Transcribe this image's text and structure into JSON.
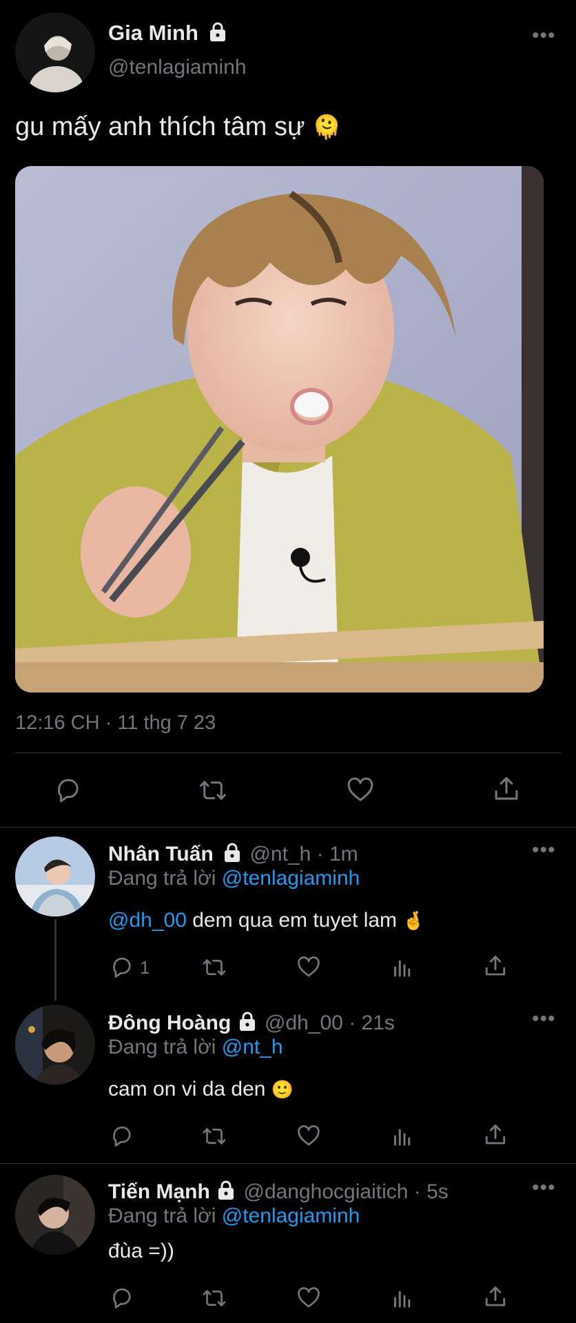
{
  "main_tweet": {
    "display_name": "Gia Minh",
    "handle": "@tenlagiaminh",
    "text": "gu mấy anh thích tâm sự",
    "emoji": "🫠",
    "timestamp": "12:16 CH · 11 thg 7 23"
  },
  "replies": [
    {
      "display_name": "Nhân Tuấn",
      "handle_time": "@nt_h · 1m",
      "replying_prefix": "Đang trả lời",
      "replying_to": "@tenlagiaminh",
      "mention": "@dh_00",
      "text": "dem qua em tuyet lam",
      "emoji": "🤞",
      "reply_count": "1"
    },
    {
      "display_name": "Đông Hoàng",
      "handle_time": "@dh_00 · 21s",
      "replying_prefix": "Đang trả lời",
      "replying_to": "@nt_h",
      "text": "cam on vi da den",
      "emoji": "🙂"
    },
    {
      "display_name": "Tiến Mạnh",
      "handle_time": "@danghocgiaitich · 5s",
      "replying_prefix": "Đang trả lời",
      "replying_to": "@tenlagiaminh",
      "text": "đùa =))"
    }
  ],
  "icons": {
    "more": "more-icon",
    "lock": "lock-icon",
    "reply": "reply-icon",
    "retweet": "retweet-icon",
    "like": "like-icon",
    "views": "views-icon",
    "share": "share-icon"
  },
  "colors": {
    "background": "#000000",
    "text": "#e7e9ea",
    "secondary": "#71767b",
    "link": "#1d9bf0",
    "divider": "#2f3336"
  }
}
